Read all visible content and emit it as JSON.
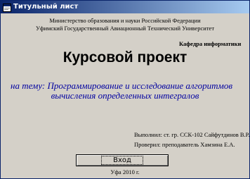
{
  "window": {
    "title": "Титульный лист"
  },
  "header": {
    "ministry": "Министерство образования и науки Российской Федерации",
    "university": "Уфимский Государственный Авиационный Технический Университет",
    "department": "Кафедра информатики"
  },
  "main": {
    "title": "Курсовой проект",
    "topic_line1": "на тему: Программирование и исследование алгоритмов",
    "topic_line2": "вычисления определенных интегралов"
  },
  "authors": {
    "performed": "Выполнил: ст. гр. ССК-102 Сайфутдинов В.Р.",
    "checked": "Проверил: преподаватель Хамзина Е.А."
  },
  "buttons": {
    "enter_label": "Вход"
  },
  "footer": {
    "city_year": "Уфа 2010 г."
  },
  "colors": {
    "titlebar_start": "#0a246a",
    "titlebar_end": "#a6caf0",
    "window_background": "#d4d0c8",
    "topic_text": "#0000a0"
  },
  "icons": {
    "title": "app-form-icon"
  }
}
